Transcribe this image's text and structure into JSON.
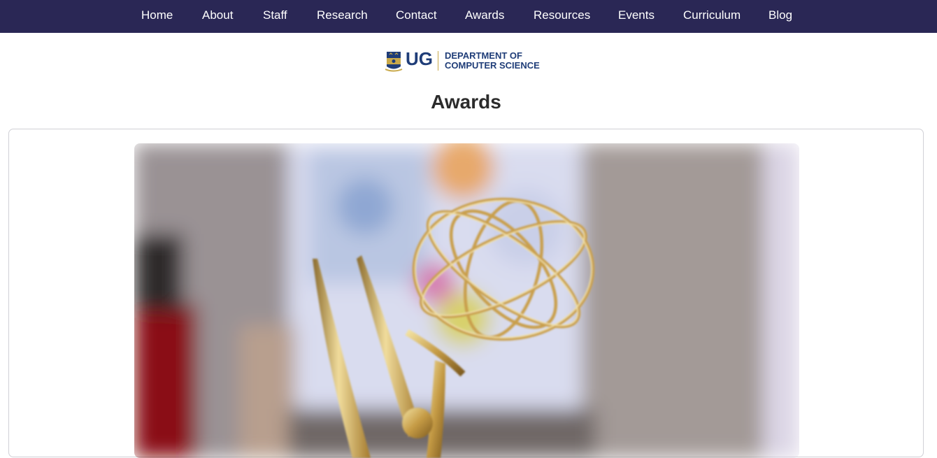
{
  "nav": {
    "items": [
      {
        "label": "Home"
      },
      {
        "label": "About"
      },
      {
        "label": "Staff"
      },
      {
        "label": "Research"
      },
      {
        "label": "Contact"
      },
      {
        "label": "Awards"
      },
      {
        "label": "Resources"
      },
      {
        "label": "Events"
      },
      {
        "label": "Curriculum"
      },
      {
        "label": "Blog"
      }
    ]
  },
  "logo": {
    "mark": "UG",
    "line1": "DEPARTMENT OF",
    "line2": "COMPUTER SCIENCE"
  },
  "page": {
    "title": "Awards"
  },
  "colors": {
    "navbar": "#2a2755",
    "brand_blue": "#1f3d78",
    "brand_gold": "#c9a94a"
  }
}
